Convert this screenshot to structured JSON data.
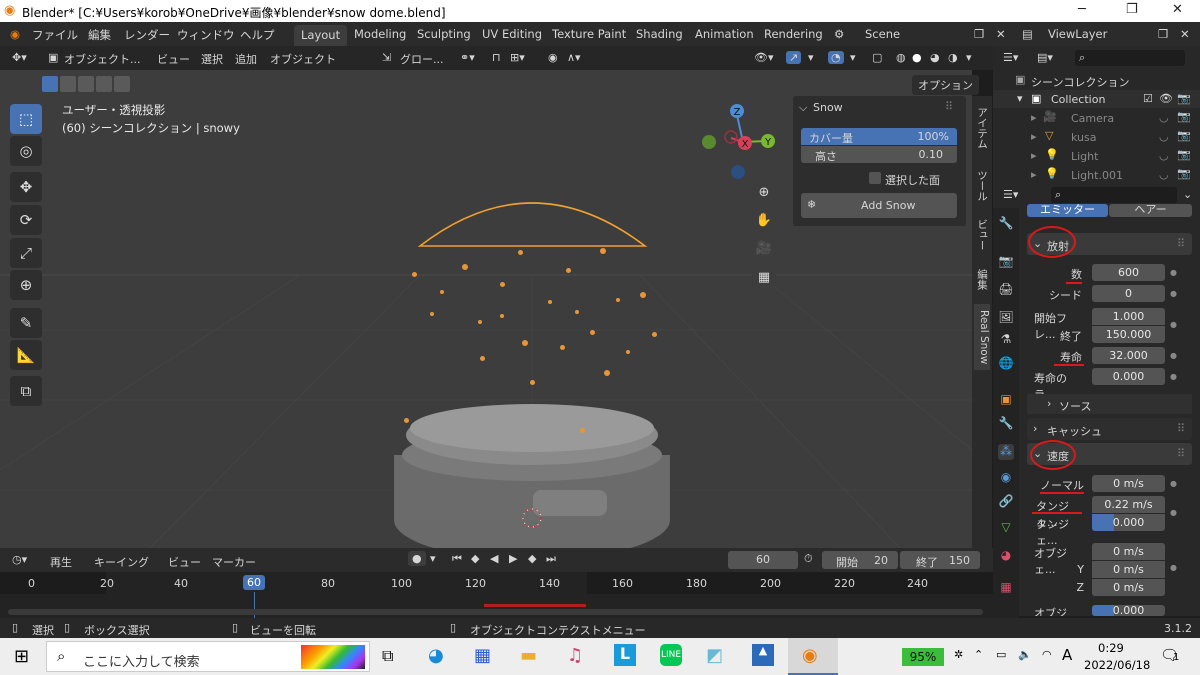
{
  "title": "Blender* [C:¥Users¥korob¥OneDrive¥画像¥blender¥snow dome.blend]",
  "menus": [
    "ファイル",
    "編集",
    "レンダー",
    "ウィンドウ",
    "ヘルプ"
  ],
  "workspaces": [
    "Layout",
    "Modeling",
    "Sculpting",
    "UV Editing",
    "Texture Paint",
    "Shading",
    "Animation",
    "Rendering"
  ],
  "active_workspace": "Layout",
  "scene": "Scene",
  "viewlayer": "ViewLayer",
  "viewport_header": {
    "mode": "オブジェクト...",
    "items": [
      "ビュー",
      "選択",
      "追加",
      "オブジェクト"
    ],
    "transform": "グロー...",
    "options": "オプション"
  },
  "viewport_info": {
    "line1": "ユーザー・透視投影",
    "line2": "(60) シーンコレクション | snowy"
  },
  "gizmo": {
    "z": "Z",
    "y": "Y",
    "x": "X"
  },
  "npanel": {
    "title": "Snow",
    "coverage_label": "カバー量",
    "coverage_value": "100%",
    "height_label": "高さ",
    "height_value": "0.10",
    "selected_faces": "選択した面",
    "add_button": "Add Snow"
  },
  "vtabs": [
    "アイテム",
    "ツール",
    "ビュー",
    "編集",
    "Real Snow"
  ],
  "outliner": {
    "root": "シーンコレクション",
    "items": [
      "Collection",
      "Camera",
      "kusa",
      "Light",
      "Light.001"
    ]
  },
  "props": {
    "tabs": [
      "エミッター",
      "ヘアー"
    ],
    "emission_header": "放射",
    "count_label": "数",
    "count_value": "600",
    "seed_label": "シード",
    "seed_value": "0",
    "start_label": "開始フレ...",
    "start_value": "1.000",
    "end_label": "終了",
    "end_value": "150.000",
    "lifetime_label": "寿命",
    "lifetime_value": "32.000",
    "lifetime_rand_label": "寿命のラ...",
    "lifetime_rand_value": "0.000",
    "source": "ソース",
    "cache": "キャッシュ",
    "velocity_header": "速度",
    "normal_label": "ノーマル",
    "normal_value": "0 m/s",
    "tangent_label": "タンジェ...",
    "tangent_value": "0.22 m/s",
    "tangent_phase_label": "タンジェ...",
    "tangent_phase_value": "0.000",
    "object_label": "オブジェ...",
    "object_value": "0 m/s",
    "y_label": "Y",
    "y_value": "0 m/s",
    "z_label": "Z",
    "z_value": "0 m/s",
    "object2_label": "オブジェ...",
    "object2_value": "0.000"
  },
  "timeline": {
    "menus": [
      "再生",
      "キーイング",
      "ビュー",
      "マーカー"
    ],
    "current_frame": "60",
    "start_label": "開始",
    "start": "20",
    "end_label": "終了",
    "end": "150",
    "ticks": [
      "0",
      "20",
      "40",
      "60",
      "80",
      "100",
      "120",
      "140",
      "160",
      "180",
      "200",
      "220",
      "240"
    ]
  },
  "status": {
    "select": "選択",
    "box_select": "ボックス選択",
    "rotate": "ビューを回転",
    "context_menu": "オブジェクトコンテクストメニュー",
    "version": "3.1.2"
  },
  "taskbar": {
    "search_placeholder": "ここに入力して検索",
    "battery": "95%",
    "ime": "A",
    "time": "0:29",
    "date": "2022/06/18",
    "notifications": "1"
  }
}
